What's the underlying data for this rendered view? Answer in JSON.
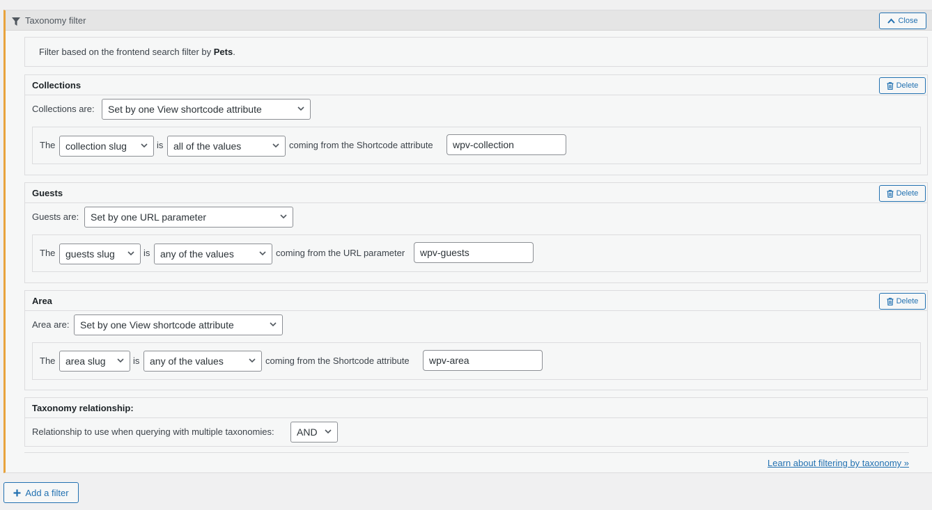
{
  "panel": {
    "title": "Taxonomy filter",
    "close_label": "Close",
    "description_prefix": "Filter based on the frontend search filter by ",
    "description_bold": "Pets",
    "description_suffix": "."
  },
  "sections": [
    {
      "title": "Collections",
      "delete_label": "Delete",
      "are_label": "Collections are:",
      "mode": "Set by one View shortcode attribute",
      "the": "The",
      "slug_select": "collection slug",
      "is": "is",
      "values_select": "all of the values",
      "coming_from": "coming from the Shortcode attribute",
      "attr_value": "wpv-collection"
    },
    {
      "title": "Guests",
      "delete_label": "Delete",
      "are_label": "Guests are:",
      "mode": "Set by one URL parameter",
      "the": "The",
      "slug_select": "guests slug",
      "is": "is",
      "values_select": "any of the values",
      "coming_from": "coming from the URL parameter",
      "attr_value": "wpv-guests"
    },
    {
      "title": "Area",
      "delete_label": "Delete",
      "are_label": "Area are:",
      "mode": "Set by one View shortcode attribute",
      "the": "The",
      "slug_select": "area slug",
      "is": "is",
      "values_select": "any of the values",
      "coming_from": "coming from the Shortcode attribute",
      "attr_value": "wpv-area"
    }
  ],
  "relationship": {
    "title": "Taxonomy relationship:",
    "label": "Relationship to use when querying with multiple taxonomies:",
    "value": "AND"
  },
  "footer": {
    "learn_link": "Learn about filtering by taxonomy »",
    "add_filter": "Add a filter"
  },
  "colors": {
    "accent": "#2271b1",
    "left_border": "#e8a33d"
  }
}
